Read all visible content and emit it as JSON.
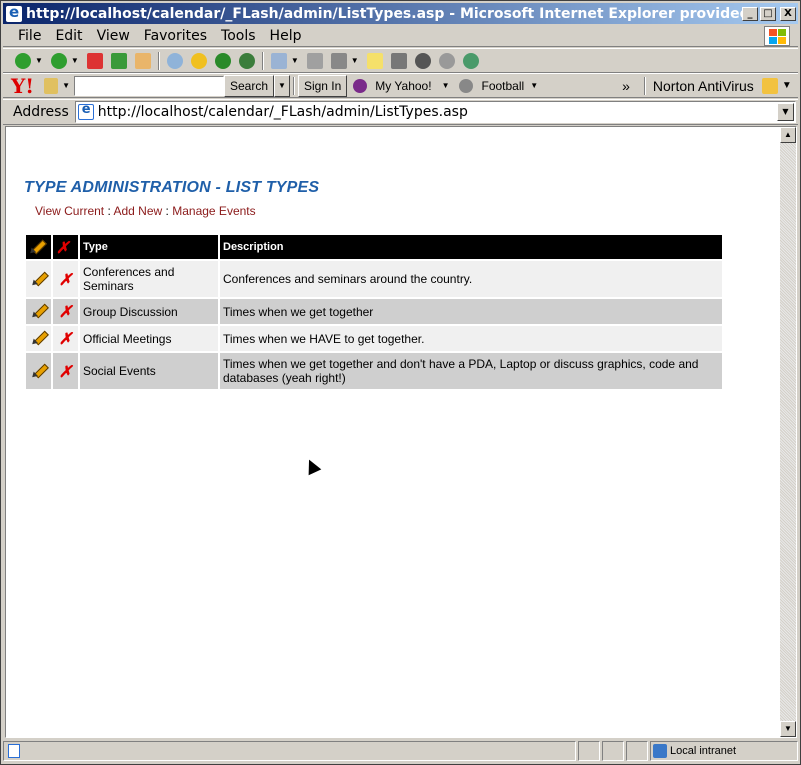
{
  "window": {
    "title": "http://localhost/calendar/_FLash/admin/ListTypes.asp - Microsoft Internet Explorer provided by AT...",
    "buttons": [
      "_",
      "□",
      "X"
    ]
  },
  "menu": {
    "items": [
      "File",
      "Edit",
      "View",
      "Favorites",
      "Tools",
      "Help"
    ]
  },
  "yahoo_toolbar": {
    "logo": "Y!",
    "search_button": "Search",
    "signin_button": "Sign In",
    "my_yahoo": "My Yahoo!",
    "football": "Football",
    "more": "»",
    "norton": "Norton AntiVirus"
  },
  "address": {
    "label": "Address",
    "url": "http://localhost/calendar/_FLash/admin/ListTypes.asp"
  },
  "page": {
    "title": "TYPE ADMINISTRATION - LIST TYPES",
    "nav": {
      "view_current": "View Current",
      "add_new": "Add New",
      "manage_events": "Manage Events",
      "separator": ":"
    },
    "table": {
      "headers": {
        "edit_glyph": "✎",
        "delete_glyph": "✗",
        "type": "Type",
        "description": "Description"
      },
      "rows": [
        {
          "type": "Conferences and Seminars",
          "description": "Conferences and seminars around the country."
        },
        {
          "type": "Group Discussion",
          "description": "Times when we get together"
        },
        {
          "type": "Official Meetings",
          "description": "Times when we HAVE to get together."
        },
        {
          "type": "Social Events",
          "description": "Times when we get together and don't have a PDA, Laptop or discuss graphics, code and databases (yeah right!)"
        }
      ],
      "delete_glyph": "✗"
    }
  },
  "status": {
    "zone": "Local intranet"
  },
  "colors": {
    "title_blue": "#1f5fa9",
    "link_red": "#8b1a1a",
    "header_bg": "#000000",
    "row_light": "#f0f0f0",
    "row_dark": "#cfcfcf",
    "delete_red": "#e00000"
  }
}
